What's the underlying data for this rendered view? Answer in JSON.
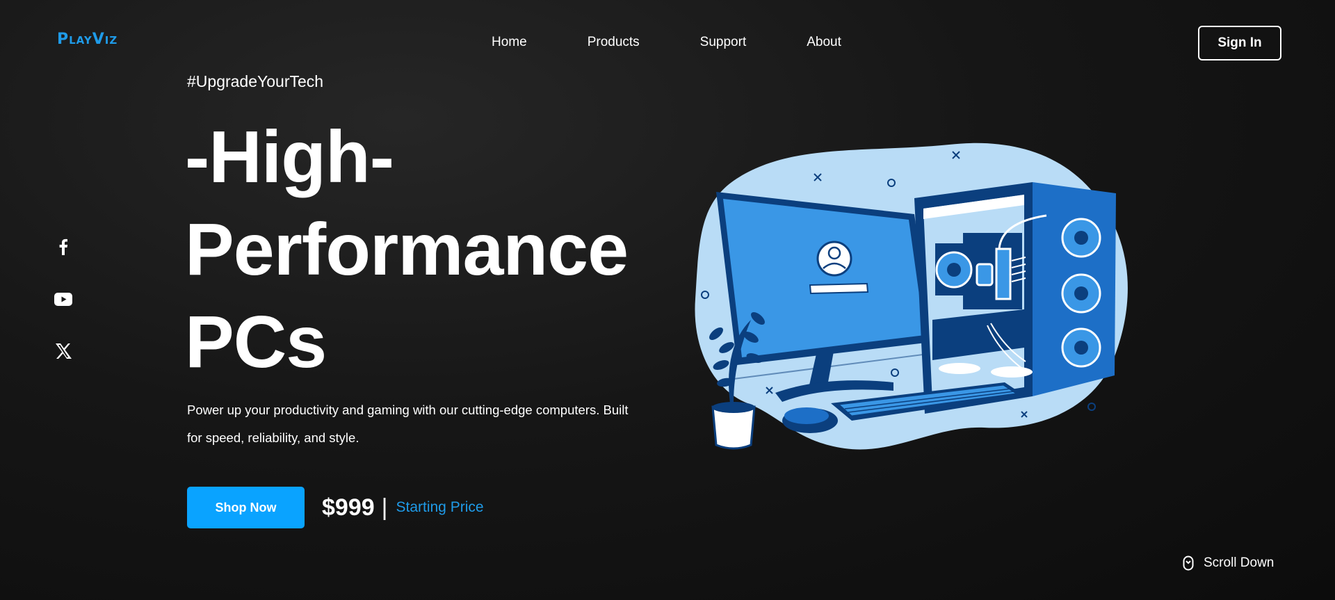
{
  "brand": {
    "logo_text": "PlayViz",
    "accent": "#1f9be8"
  },
  "nav": {
    "items": [
      "Home",
      "Products",
      "Support",
      "About"
    ],
    "sign_in_label": "Sign In"
  },
  "social": {
    "icons": [
      "facebook-icon",
      "youtube-icon",
      "x-icon"
    ]
  },
  "hero": {
    "hashtag": "#UpgradeYourTech",
    "headline_lines": [
      "-High-",
      "Performance",
      "PCs"
    ],
    "description": "Power up your productivity and gaming with our cutting-edge computers. Built for speed, reliability, and style.",
    "cta_label": "Shop Now",
    "price": "$999",
    "separator": "|",
    "price_label": "Starting Price",
    "cta_color": "#0aa3ff"
  },
  "scroll": {
    "label": "Scroll Down",
    "icon": "mouse-icon"
  },
  "illustration": {
    "subject": "desktop-pc-illustration",
    "colors": [
      "#b9dcf6",
      "#3a97e6",
      "#0b3f7e"
    ]
  }
}
